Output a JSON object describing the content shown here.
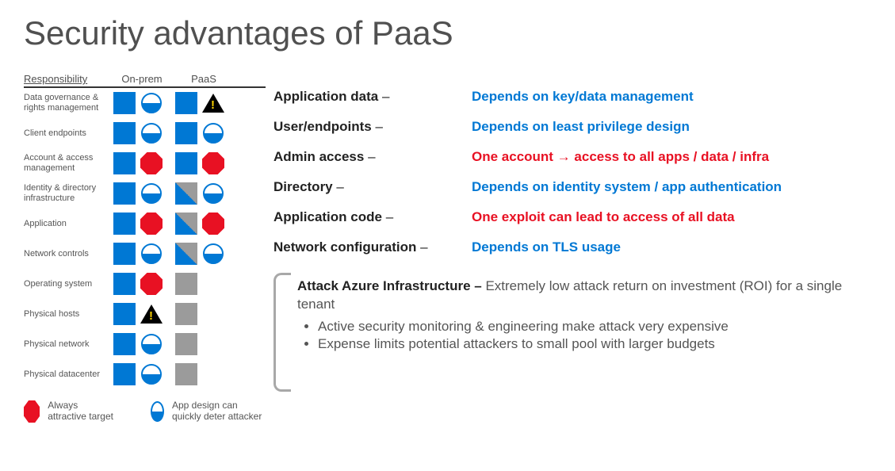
{
  "title": "Security advantages of PaaS",
  "columns": {
    "c0": "Responsibility",
    "c1": "On-prem",
    "c2": "PaaS"
  },
  "rows": [
    {
      "label": "Data governance & rights management"
    },
    {
      "label": "Client endpoints"
    },
    {
      "label": "Account & access management"
    },
    {
      "label": "Identity & directory infrastructure"
    },
    {
      "label": "Application"
    },
    {
      "label": "Network controls"
    },
    {
      "label": "Operating system"
    },
    {
      "label": "Physical hosts"
    },
    {
      "label": "Physical network"
    },
    {
      "label": "Physical datacenter"
    }
  ],
  "lines": [
    {
      "head": "Application data",
      "desc": "Depends on key/data management",
      "color": "blue"
    },
    {
      "head": "User/endpoints",
      "desc": "Depends on least privilege design",
      "color": "blue"
    },
    {
      "head": "Admin access",
      "desc": "One account → access to all apps / data / infra",
      "color": "red"
    },
    {
      "head": "Directory",
      "desc": "Depends on identity system / app authentication",
      "color": "blue"
    },
    {
      "head": "Application code",
      "desc": "One exploit can lead to access of all data",
      "color": "red"
    },
    {
      "head": "Network configuration",
      "desc": "Depends on TLS usage",
      "color": "blue"
    }
  ],
  "infra": {
    "head": "Attack Azure Infrastructure –",
    "body": "Extremely low attack return on investment (ROI) for a single tenant",
    "bullets": [
      "Active security monitoring & engineering make attack very expensive",
      "Expense limits potential attackers to small pool with larger budgets"
    ]
  },
  "legend": {
    "a": "Always attractive target",
    "b": "App design can quickly deter attacker"
  },
  "dash": " –"
}
